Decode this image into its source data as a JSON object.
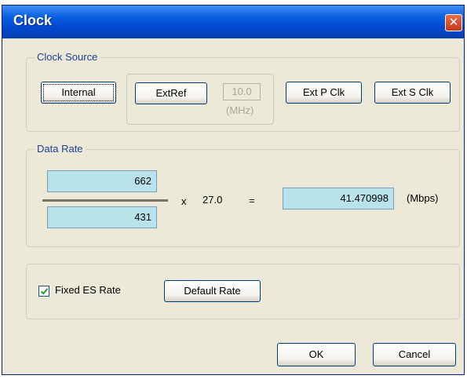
{
  "window": {
    "title": "Clock",
    "close_glyph": "✕"
  },
  "clock_source": {
    "legend": "Clock Source",
    "buttons": {
      "internal": "Internal",
      "ext_ref": "ExtRef",
      "ext_p_clk": "Ext P Clk",
      "ext_s_clk": "Ext S Clk"
    },
    "ext_ref_value": "10.0",
    "ext_ref_unit": "(MHz)"
  },
  "data_rate": {
    "legend": "Data Rate",
    "numerator": "662",
    "denominator": "431",
    "times_symbol": "x",
    "multiplier": "27.0",
    "equals_symbol": "=",
    "result": "41.470998",
    "unit": "(Mbps)"
  },
  "options": {
    "fixed_es_rate_label": "Fixed ES Rate",
    "fixed_es_rate_checked": true,
    "default_rate_button": "Default Rate"
  },
  "footer": {
    "ok": "OK",
    "cancel": "Cancel"
  },
  "colors": {
    "field_bg": "#b8e3eb",
    "title_bar": "#0149d2",
    "close_button": "#c2391b"
  }
}
